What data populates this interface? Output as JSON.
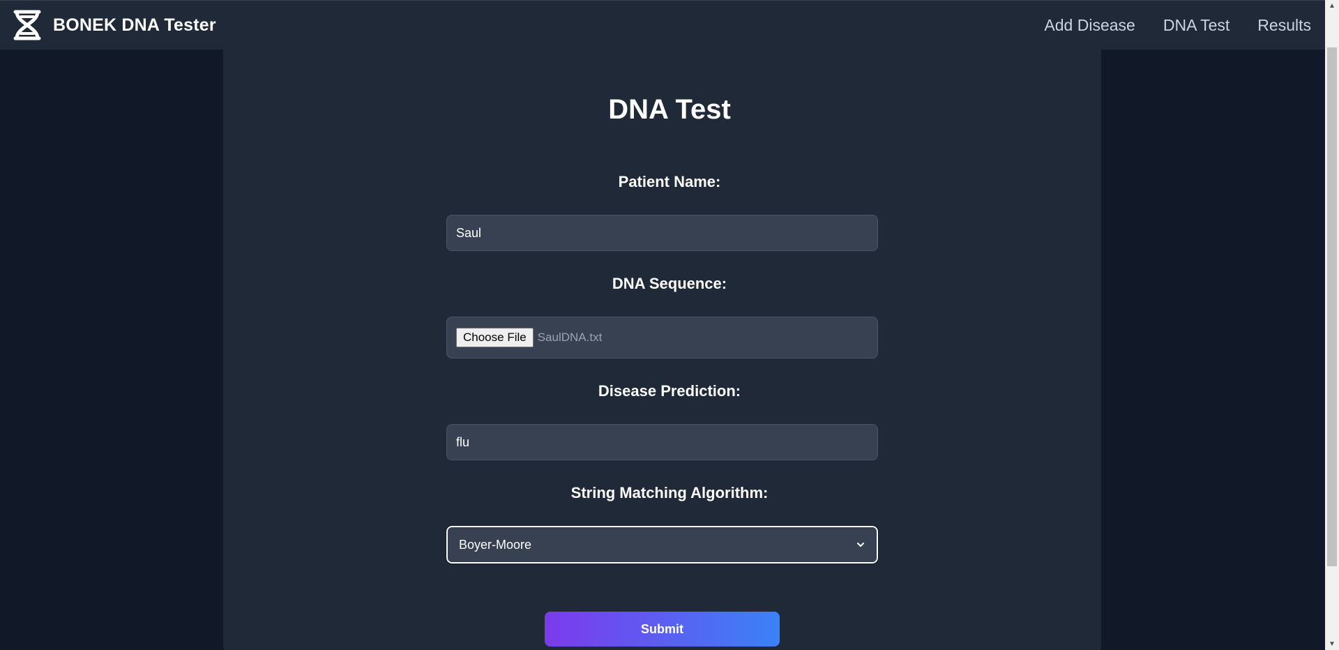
{
  "header": {
    "brand_title": "BONEK DNA Tester",
    "logo_icon": "dna-icon",
    "nav": [
      {
        "label": "Add Disease"
      },
      {
        "label": "DNA Test"
      },
      {
        "label": "Results"
      }
    ]
  },
  "form": {
    "title": "DNA Test",
    "patient_label": "Patient Name:",
    "patient_value": "Saul",
    "dna_label": "DNA Sequence:",
    "file_button": "Choose File",
    "file_name": "SaulDNA.txt",
    "disease_label": "Disease Prediction:",
    "disease_value": "flu",
    "algorithm_label": "String Matching Algorithm:",
    "algorithm_value": "Boyer-Moore",
    "submit_label": "Submit"
  },
  "colors": {
    "background": "#111827",
    "surface": "#1f2937",
    "field": "#374151",
    "gradient_start": "#7c3aed",
    "gradient_end": "#3b82f6"
  }
}
